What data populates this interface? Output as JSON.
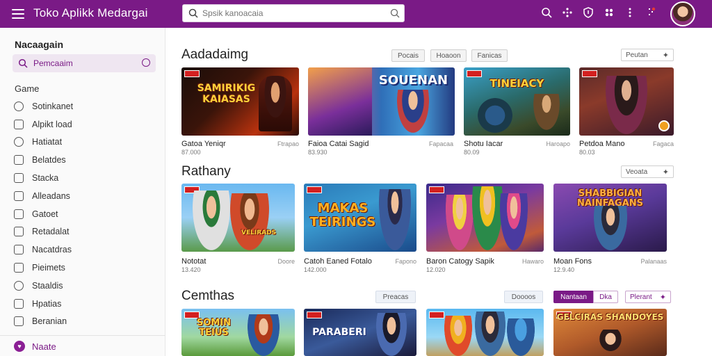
{
  "app": {
    "title": "Toko Aplikk Medargai"
  },
  "search": {
    "placeholder": "Spsik kanoacaia"
  },
  "topbar": {
    "icons": [
      "search-icon",
      "apps-icon",
      "shield-icon",
      "puzzle-icon",
      "more-icon",
      "notification-icon"
    ]
  },
  "sidebar": {
    "heading": "Nacaagain",
    "active_label": "Pemcaaim",
    "subheading": "Game",
    "items": [
      {
        "label": "Sotinkanet",
        "icon": "clock-icon"
      },
      {
        "label": "Alpikt load",
        "icon": "folder-icon"
      },
      {
        "label": "Hatiatat",
        "icon": "history-icon"
      },
      {
        "label": "Belatdes",
        "icon": "list-icon"
      },
      {
        "label": "Stacka",
        "icon": "stack-icon"
      },
      {
        "label": "Alleadans",
        "icon": "people-icon"
      },
      {
        "label": "Gatoet",
        "icon": "gift-icon"
      },
      {
        "label": "Retadalat",
        "icon": "doc-icon"
      },
      {
        "label": "Nacatdras",
        "icon": "box-icon"
      },
      {
        "label": "Pieimets",
        "icon": "star-icon"
      },
      {
        "label": "Staaldis",
        "icon": "chart-icon"
      },
      {
        "label": "Hpatias",
        "icon": "tag-icon"
      },
      {
        "label": "Beranian",
        "icon": "wallet-icon"
      }
    ],
    "bottom_label": "Naate"
  },
  "sections": [
    {
      "title": "Aadadaimg",
      "pills": [
        "Pocais",
        "Hoaoon",
        "Fanicas"
      ],
      "more_label": "Peutan",
      "cards": [
        {
          "name": "Gatoa Yeniqr",
          "meta": "Ftrapao",
          "price": "87.000",
          "art": "SAMIRIKIG KAIASAS"
        },
        {
          "name": "Faioa Catai Sagid",
          "meta": "Fapacaa",
          "price": "83.930",
          "art": "SOUENAN"
        },
        {
          "name": "Shotu Iacar",
          "meta": "Haroapo",
          "price": "80.09",
          "art": "TINEIACY"
        },
        {
          "name": "Petdoa Mano",
          "meta": "Fagaca",
          "price": "80.03",
          "art": ""
        }
      ]
    },
    {
      "title": "Rathany",
      "pills": [],
      "more_label": "Veoata",
      "cards": [
        {
          "name": "Nototat",
          "meta": "Doore",
          "price": "13.420",
          "art": "VELIRADS"
        },
        {
          "name": "Catoh Eaned Fotalo",
          "meta": "Fapono",
          "price": "142.000",
          "art": "MAKAS TEIRINGS"
        },
        {
          "name": "Baron Catogy Sapik",
          "meta": "Hawaro",
          "price": "12.020",
          "art": ""
        },
        {
          "name": "Moan Fons",
          "meta": "Palanaas",
          "price": "12.9.40",
          "art": "SHABBIGIAN NAINFAGANS"
        }
      ]
    },
    {
      "title": "Cemthas",
      "pills": [
        "Preacas",
        "Doooos"
      ],
      "toggle": [
        "Nantaan",
        "Dka"
      ],
      "more_label": "Plerant",
      "cards": [
        {
          "name": "",
          "meta": "",
          "price": "",
          "art": "SOMIN TEIUS"
        },
        {
          "name": "",
          "meta": "",
          "price": "",
          "art": "PARABERI"
        },
        {
          "name": "",
          "meta": "",
          "price": "",
          "art": ""
        },
        {
          "name": "",
          "meta": "",
          "price": "",
          "art": "GELCIRAS SHANDOYES"
        }
      ]
    }
  ],
  "colors": {
    "brand": "#7a1a86",
    "accent_red": "#d32020"
  }
}
